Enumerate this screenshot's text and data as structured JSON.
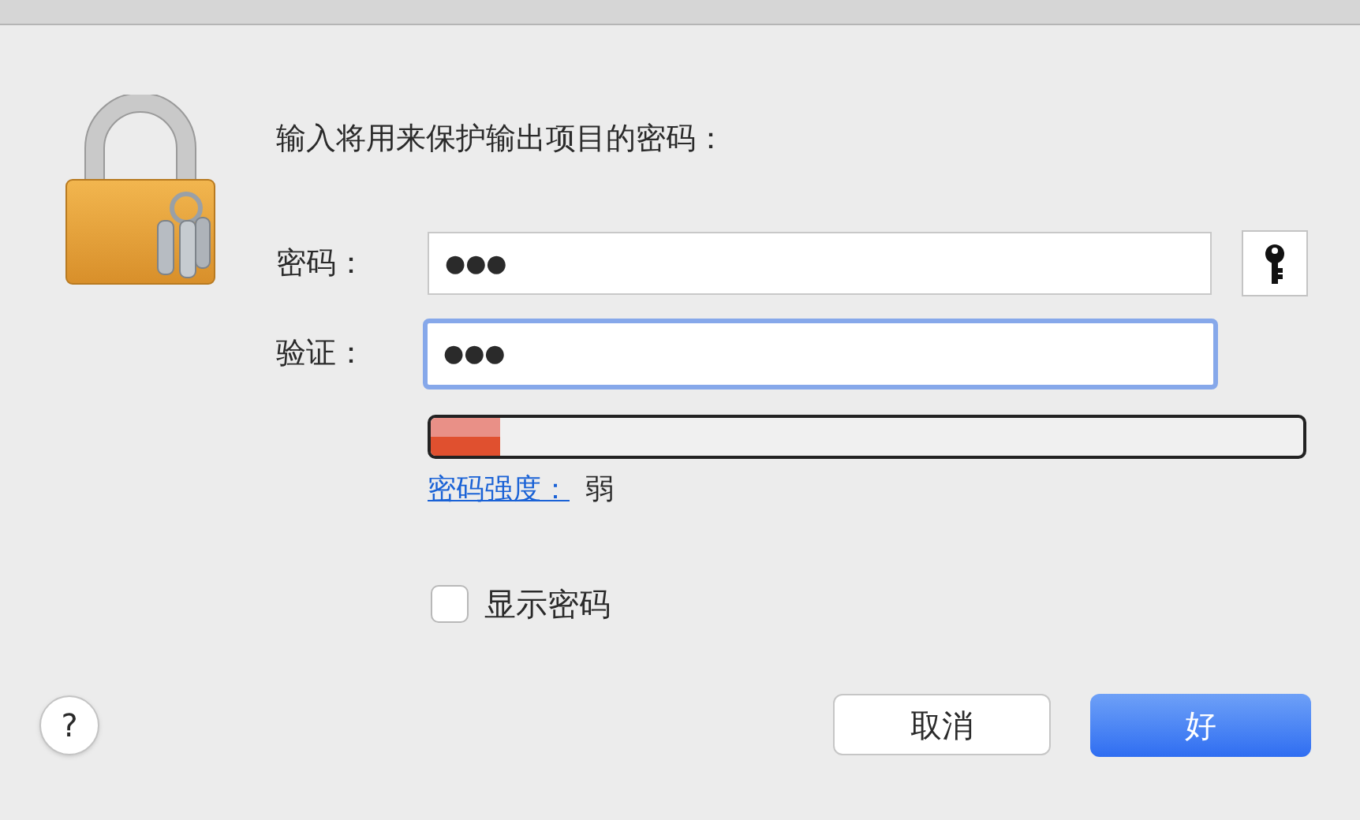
{
  "prompt": "输入将用来保护输出项目的密码：",
  "fields": [
    {
      "label": "密码：",
      "value": "●●●",
      "focused": false
    },
    {
      "label": "验证：",
      "value": "●●●",
      "focused": true
    }
  ],
  "strength": {
    "level": 0.08,
    "link": "密码强度：",
    "reading": "弱"
  },
  "show_password": {
    "label": "显示密码",
    "checked": false
  },
  "help_button": "?",
  "buttons": [
    {
      "label": "取消",
      "kind": "secondary"
    },
    {
      "label": "好",
      "kind": "primary"
    }
  ]
}
